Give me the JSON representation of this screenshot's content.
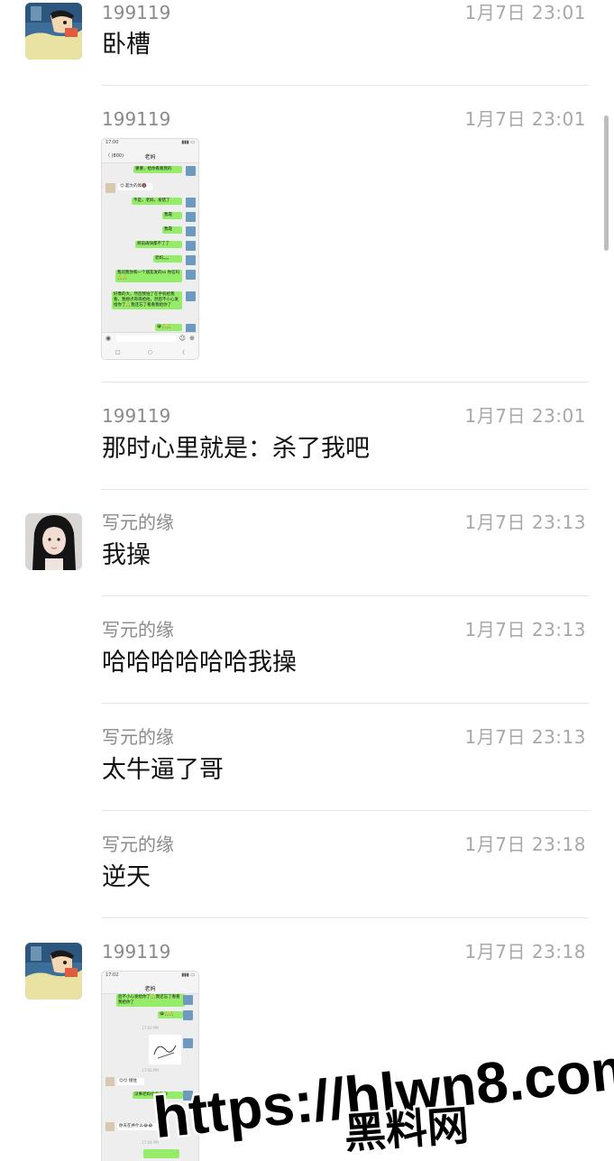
{
  "messages": [
    {
      "name": "199119",
      "time": "1月7日 23:01",
      "text": "卧槽",
      "avatar": "cartoon-boy"
    },
    {
      "name": "199119",
      "time": "1月7日 23:01",
      "image": "chat-screenshot"
    },
    {
      "name": "199119",
      "time": "1月7日 23:01",
      "text": "那时心里就是：杀了我吧"
    },
    {
      "name": "写元的缘",
      "time": "1月7日 23:13",
      "text": "我操",
      "avatar": "girl-photo"
    },
    {
      "name": "写元的缘",
      "time": "1月7日 23:13",
      "text": "哈哈哈哈哈哈我操"
    },
    {
      "name": "写元的缘",
      "time": "1月7日 23:13",
      "text": "太牛逼了哥"
    },
    {
      "name": "写元的缘",
      "time": "1月7日 23:18",
      "text": "逆天"
    },
    {
      "name": "199119",
      "time": "1月7日 23:18",
      "image": "chat-screenshot",
      "avatar": "cartoon-boy"
    }
  ],
  "thumb1": {
    "status_time": "17:00",
    "title": "老妈",
    "back": "〈 (800)",
    "bubbles": [
      {
        "side": "right",
        "text": "婆婆，给你看看我的"
      },
      {
        "side": "left",
        "text": "😊 超大的屌🔞"
      },
      {
        "side": "right",
        "text": "不是，老妈，发错了"
      },
      {
        "side": "right",
        "text": "我靠"
      },
      {
        "side": "right",
        "text": "我靠"
      },
      {
        "side": "right",
        "text": "目前再快都不了了"
      },
      {
        "side": "right",
        "text": "老妈。。。"
      },
      {
        "side": "right",
        "text": "我问我你和一个朋友发的ss 你信吗🙏🙏"
      },
      {
        "side": "right",
        "text": "好像的大，然后我怕了在手机给我看，我想点哥哥给他，然后不小心发给你了🙏我还忘了看看我给你了"
      },
      {
        "side": "right",
        "text": "😭🙏🙏"
      }
    ],
    "nav": [
      "□",
      "○",
      "〈"
    ]
  },
  "thumb2": {
    "status_time": "17:02",
    "title": "老妈",
    "bubbles_top": [
      {
        "side": "right",
        "text": "后不小心发给你了🙏我还忘了看看我给你了"
      },
      {
        "side": "right",
        "text": "😭🙏🙏"
      }
    ],
    "divider1": "17:02 PM",
    "divider2": "17:02 PM",
    "bubbles_bottom": [
      {
        "side": "left",
        "text": "😊😊 接住"
      },
      {
        "side": "right",
        "text": "没事老妈😄😄😄😄"
      },
      {
        "side": "left",
        "text": "你天在并什么😂😂"
      }
    ],
    "divider3": "17:04 PM"
  },
  "watermark": {
    "url": "https://hlwn8.com",
    "name": "黑料网"
  }
}
